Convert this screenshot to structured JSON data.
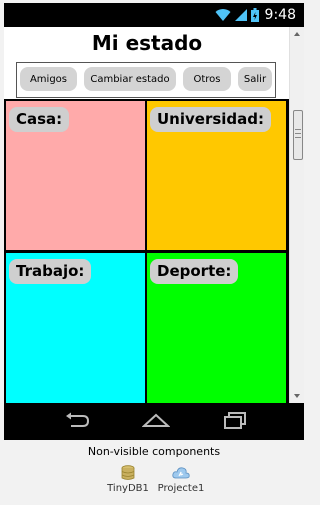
{
  "status_bar": {
    "time": "9:48"
  },
  "screen": {
    "title": "Mi estado",
    "buttons": [
      "Amigos",
      "Cambiar estado",
      "Otros",
      "Salir"
    ],
    "cells": [
      {
        "label": "Casa:",
        "color": "#ffaaaa"
      },
      {
        "label": "Universidad:",
        "color": "#ffc800"
      },
      {
        "label": "Trabajo:",
        "color": "#00ffff"
      },
      {
        "label": "Deporte:",
        "color": "#00ff00"
      }
    ]
  },
  "nav": {
    "icons": [
      "back-icon",
      "home-icon",
      "recent-apps-icon"
    ]
  },
  "designer": {
    "nonvisible_title": "Non-visible components",
    "components": [
      {
        "name": "TinyDB1",
        "icon": "database-icon"
      },
      {
        "name": "Projecte1",
        "icon": "cloud-icon"
      }
    ]
  }
}
